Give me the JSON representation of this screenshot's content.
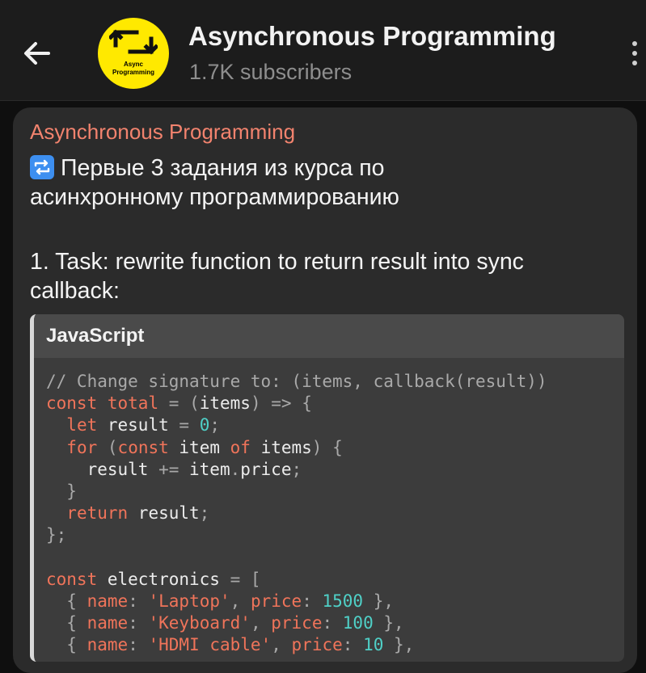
{
  "header": {
    "back_icon": "arrow-left-icon",
    "channel_title": "Asynchronous Programming",
    "subscribers": "1.7K subscribers",
    "avatar": {
      "logo_icon": "swap-arrows-icon",
      "line1": "Async",
      "line2": "Programming",
      "bg_color": "#ffe900"
    },
    "menu_icon": "vertical-dots-icon"
  },
  "message": {
    "sender": "Asynchronous Programming",
    "emoji_icon": "repeat-emoji-icon",
    "text_line1": "Первые 3 задания из курса по",
    "text_line2": "асинхронному программированию",
    "task_line1": "1. Task: rewrite function to return result into sync",
    "task_line2": "callback:",
    "code_block": {
      "language": "JavaScript",
      "lines": [
        [
          {
            "t": "comment",
            "v": "// Change signature to: (items, callback(result))"
          }
        ],
        [
          {
            "t": "kw",
            "v": "const"
          },
          {
            "t": "plain",
            "v": " "
          },
          {
            "t": "kw",
            "v": "total"
          },
          {
            "t": "plain",
            "v": " "
          },
          {
            "t": "punc",
            "v": "="
          },
          {
            "t": "plain",
            "v": " "
          },
          {
            "t": "punc",
            "v": "("
          },
          {
            "t": "plain",
            "v": "items"
          },
          {
            "t": "punc",
            "v": ")"
          },
          {
            "t": "plain",
            "v": " "
          },
          {
            "t": "punc",
            "v": "=>"
          },
          {
            "t": "plain",
            "v": " "
          },
          {
            "t": "punc",
            "v": "{"
          }
        ],
        [
          {
            "t": "plain",
            "v": "  "
          },
          {
            "t": "kw",
            "v": "let"
          },
          {
            "t": "plain",
            "v": " result "
          },
          {
            "t": "punc",
            "v": "="
          },
          {
            "t": "plain",
            "v": " "
          },
          {
            "t": "num",
            "v": "0"
          },
          {
            "t": "punc",
            "v": ";"
          }
        ],
        [
          {
            "t": "plain",
            "v": "  "
          },
          {
            "t": "kw",
            "v": "for"
          },
          {
            "t": "plain",
            "v": " "
          },
          {
            "t": "punc",
            "v": "("
          },
          {
            "t": "kw",
            "v": "const"
          },
          {
            "t": "plain",
            "v": " item "
          },
          {
            "t": "kw",
            "v": "of"
          },
          {
            "t": "plain",
            "v": " items"
          },
          {
            "t": "punc",
            "v": ")"
          },
          {
            "t": "plain",
            "v": " "
          },
          {
            "t": "punc",
            "v": "{"
          }
        ],
        [
          {
            "t": "plain",
            "v": "    result "
          },
          {
            "t": "punc",
            "v": "+="
          },
          {
            "t": "plain",
            "v": " item"
          },
          {
            "t": "punc",
            "v": "."
          },
          {
            "t": "plain",
            "v": "price"
          },
          {
            "t": "punc",
            "v": ";"
          }
        ],
        [
          {
            "t": "plain",
            "v": "  "
          },
          {
            "t": "punc",
            "v": "}"
          }
        ],
        [
          {
            "t": "plain",
            "v": "  "
          },
          {
            "t": "kw",
            "v": "return"
          },
          {
            "t": "plain",
            "v": " result"
          },
          {
            "t": "punc",
            "v": ";"
          }
        ],
        [
          {
            "t": "punc",
            "v": "};"
          }
        ],
        [
          {
            "t": "plain",
            "v": ""
          }
        ],
        [
          {
            "t": "kw",
            "v": "const"
          },
          {
            "t": "plain",
            "v": " electronics "
          },
          {
            "t": "punc",
            "v": "="
          },
          {
            "t": "plain",
            "v": " "
          },
          {
            "t": "punc",
            "v": "["
          }
        ],
        [
          {
            "t": "plain",
            "v": "  "
          },
          {
            "t": "punc",
            "v": "{"
          },
          {
            "t": "plain",
            "v": " "
          },
          {
            "t": "kw",
            "v": "name"
          },
          {
            "t": "punc",
            "v": ":"
          },
          {
            "t": "plain",
            "v": " "
          },
          {
            "t": "str",
            "v": "'Laptop'"
          },
          {
            "t": "punc",
            "v": ","
          },
          {
            "t": "plain",
            "v": " "
          },
          {
            "t": "kw",
            "v": "price"
          },
          {
            "t": "punc",
            "v": ":"
          },
          {
            "t": "plain",
            "v": " "
          },
          {
            "t": "num",
            "v": "1500"
          },
          {
            "t": "plain",
            "v": " "
          },
          {
            "t": "punc",
            "v": "},"
          }
        ],
        [
          {
            "t": "plain",
            "v": "  "
          },
          {
            "t": "punc",
            "v": "{"
          },
          {
            "t": "plain",
            "v": " "
          },
          {
            "t": "kw",
            "v": "name"
          },
          {
            "t": "punc",
            "v": ":"
          },
          {
            "t": "plain",
            "v": " "
          },
          {
            "t": "str",
            "v": "'Keyboard'"
          },
          {
            "t": "punc",
            "v": ","
          },
          {
            "t": "plain",
            "v": " "
          },
          {
            "t": "kw",
            "v": "price"
          },
          {
            "t": "punc",
            "v": ":"
          },
          {
            "t": "plain",
            "v": " "
          },
          {
            "t": "num",
            "v": "100"
          },
          {
            "t": "plain",
            "v": " "
          },
          {
            "t": "punc",
            "v": "},"
          }
        ],
        [
          {
            "t": "plain",
            "v": "  "
          },
          {
            "t": "punc",
            "v": "{"
          },
          {
            "t": "plain",
            "v": " "
          },
          {
            "t": "kw",
            "v": "name"
          },
          {
            "t": "punc",
            "v": ":"
          },
          {
            "t": "plain",
            "v": " "
          },
          {
            "t": "str",
            "v": "'HDMI cable'"
          },
          {
            "t": "punc",
            "v": ","
          },
          {
            "t": "plain",
            "v": " "
          },
          {
            "t": "kw",
            "v": "price"
          },
          {
            "t": "punc",
            "v": ":"
          },
          {
            "t": "plain",
            "v": " "
          },
          {
            "t": "num",
            "v": "10"
          },
          {
            "t": "plain",
            "v": " "
          },
          {
            "t": "punc",
            "v": "},"
          }
        ]
      ]
    }
  },
  "colors": {
    "sender": "#f2836e",
    "keyword": "#f0745a",
    "number": "#4fd0c7",
    "comment": "#a9a9a9"
  }
}
